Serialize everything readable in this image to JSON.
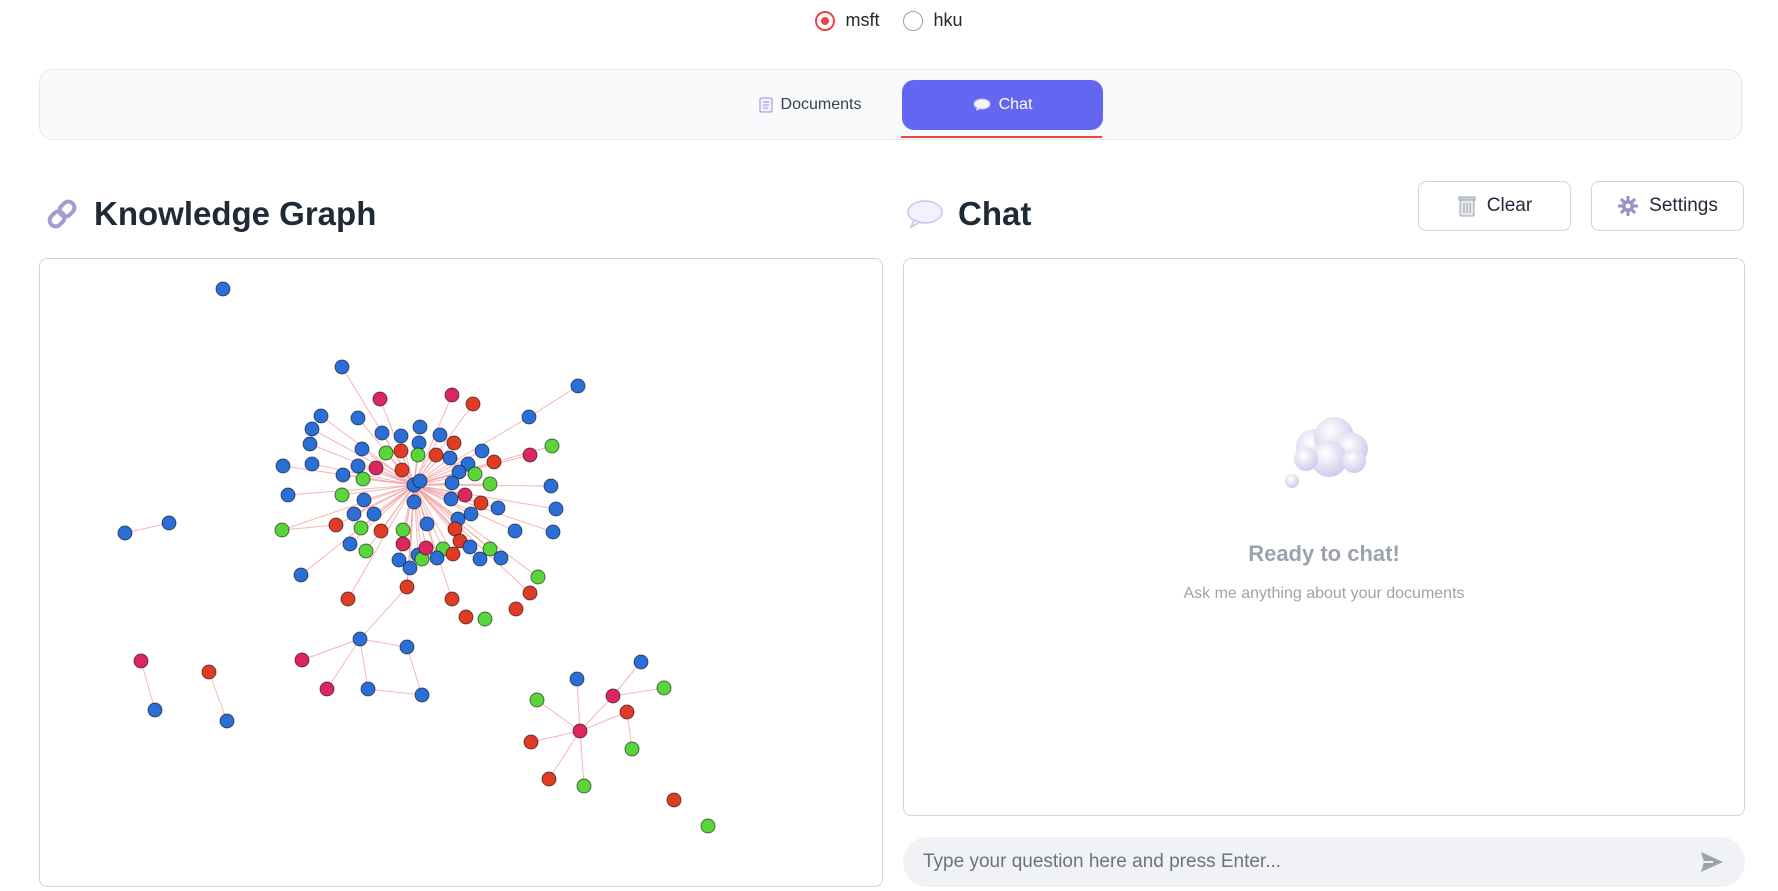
{
  "dataset_selector": {
    "options": [
      {
        "label": "msft",
        "checked": true
      },
      {
        "label": "hku",
        "checked": false
      }
    ]
  },
  "tabs": [
    {
      "label": "Documents",
      "icon": "document-icon",
      "active": false
    },
    {
      "label": "Chat",
      "icon": "speech-bubble-icon",
      "active": true
    }
  ],
  "knowledge_graph": {
    "title": "Knowledge Graph",
    "icon": "link-icon",
    "legend_colors": {
      "blue": "#2b6fd6",
      "red": "#e03b25",
      "green": "#5bd63a",
      "magenta": "#dc2660"
    },
    "edge_color": "#f4a3a3"
  },
  "chat": {
    "title": "Chat",
    "icon": "speech-bubble-icon",
    "clear_label": "Clear",
    "settings_label": "Settings",
    "empty_title": "Ready to chat!",
    "empty_subtitle": "Ask me anything about your documents",
    "input_placeholder": "Type your question here and press Enter..."
  },
  "colors": {
    "accent": "#6366f1",
    "radio_accent": "#ef4444"
  }
}
